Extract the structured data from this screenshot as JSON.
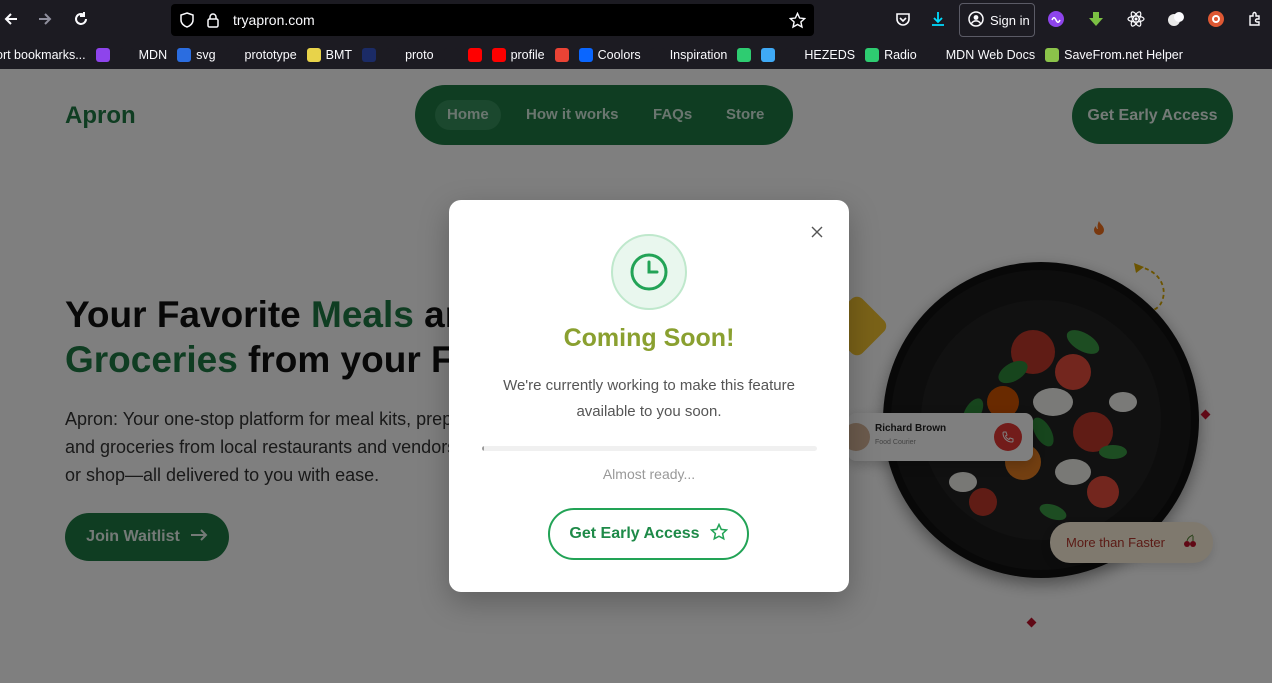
{
  "browser": {
    "url": "tryapron.com",
    "sign_in_label": "Sign in",
    "bookmarks": [
      {
        "label": "ort bookmarks...",
        "icon": "folder-icon",
        "color": "#1c1b22"
      },
      {
        "label": "",
        "icon": "purple-circle-icon",
        "color": "#8e44ec"
      },
      {
        "label": "MDN",
        "icon": "mdn-icon",
        "color": "#1c1b22"
      },
      {
        "label": "svg",
        "icon": "t-icon",
        "color": "#2b6de0"
      },
      {
        "label": "prototype",
        "icon": "prototype-icon",
        "color": "#1c1b22"
      },
      {
        "label": "BMT",
        "icon": "bmt-icon",
        "color": "#e8d34a"
      },
      {
        "label": "",
        "icon": "xe-icon",
        "color": "#1b2b66"
      },
      {
        "label": "proto",
        "icon": "proto-icon",
        "color": "#1c1b22"
      },
      {
        "label": "",
        "icon": "github-icon",
        "color": "#1c1b22"
      },
      {
        "label": "",
        "icon": "youtube-icon",
        "color": "#ff0000"
      },
      {
        "label": "profile",
        "icon": "youtube-icon",
        "color": "#ff0000"
      },
      {
        "label": "",
        "icon": "gmail-icon",
        "color": "#ea4335"
      },
      {
        "label": "Coolors",
        "icon": "coolors-icon",
        "color": "#0a66ff"
      },
      {
        "label": "Inspiration",
        "icon": "w-icon",
        "color": "#1c1b22"
      },
      {
        "label": "",
        "icon": "dashed-square-icon",
        "color": "#2ecc71"
      },
      {
        "label": "",
        "icon": "frame-icon",
        "color": "#3fa9f5"
      },
      {
        "label": "HEZEDS",
        "icon": "globe-icon",
        "color": "#1c1b22"
      },
      {
        "label": "Radio",
        "icon": "green-dot-icon",
        "color": "#2ecc71"
      },
      {
        "label": "MDN Web Docs",
        "icon": "mdn-icon",
        "color": "#1c1b22"
      },
      {
        "label": "SaveFrom.net Helper",
        "icon": "download-arrow-icon",
        "color": "#8bc34a"
      }
    ]
  },
  "site": {
    "logo": "Apron",
    "nav": [
      "Home",
      "How it works",
      "FAQs",
      "Store"
    ],
    "cta_top": "Get Early Access",
    "hero": {
      "line1_a": "Your Favorite ",
      "line1_b": "Meals",
      "line1_c": " an",
      "line2_a": "Groceries",
      "line2_b": " from your Fa",
      "desc_line1": "Apron: Your one-stop platform for meal kits, prep",
      "desc_line2": "and groceries from local restaurants and vendors",
      "desc_line3": "or shop—all delivered to you with ease.",
      "join_label": "Join Waitlist"
    },
    "courier": {
      "name": "Richard Brown",
      "role": "Food Courier"
    },
    "badge_text": "More than Faster"
  },
  "modal": {
    "title": "Coming Soon!",
    "text": "We're currently working to make this feature available to you soon.",
    "progress_percent": 0.5,
    "progress_label": "Almost ready...",
    "cta": "Get Early Access"
  }
}
